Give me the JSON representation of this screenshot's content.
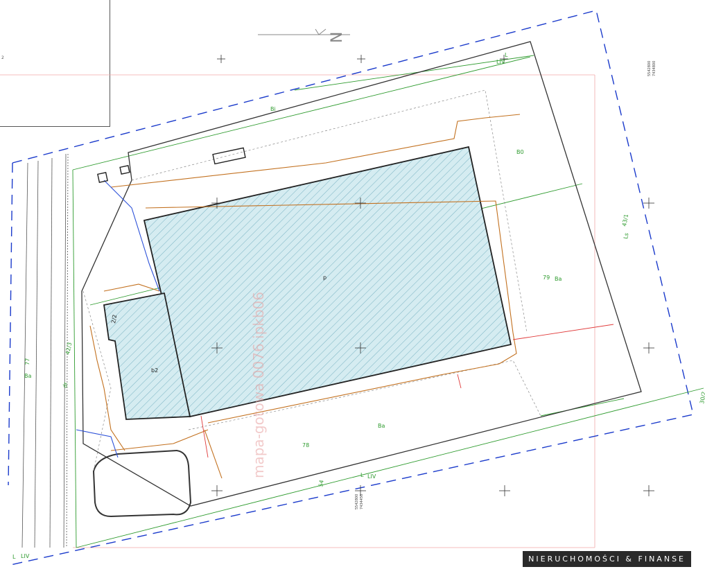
{
  "brand": "NIERUCHOMOŚCI & FINANSE",
  "watermark": "mapa-gotowa 0076.ipkb06",
  "north_arrow": "N",
  "colors": {
    "building_fill": "#cfe8ee",
    "hatch": "#7fb7c6",
    "boundary_blue": "#1a3acb",
    "utility_orange": "#c2701e",
    "green": "#2e9b2e",
    "red": "#e03a3a",
    "dark": "#222222"
  },
  "parcels": {
    "main": "79",
    "south": "78",
    "west_road": "42/3",
    "west_road2": "77",
    "east_strip": "43/1",
    "south_strip": "54",
    "se_corner": "30/2",
    "building_annex": "2/2"
  },
  "land_use": {
    "ba_main": "Ba",
    "ba_south": "Ba",
    "ba_west": "Ba",
    "bi": "Bi",
    "ls_east": "Ls",
    "lv_north": "LIV",
    "lv_south": "LIV",
    "lv_sw": "LIV",
    "dr": "dr",
    "b0": "B0",
    "l_north": "L",
    "l_south": "L",
    "l_sw": "L",
    "p_building": "p",
    "b2_annex": "b2"
  },
  "coords": {
    "ne_a": "5542800",
    "ne_b": "7434800",
    "sw_a": "5542800",
    "sw_b": "7434450"
  },
  "inset_label": "2"
}
